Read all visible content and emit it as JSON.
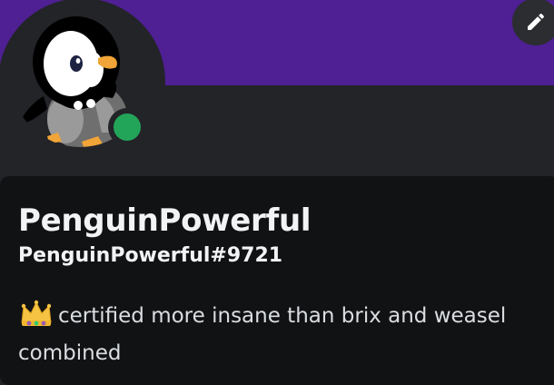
{
  "profile": {
    "display_name": "PenguinPowerful",
    "username": "PenguinPowerful#9721",
    "bio_emoji": "crown-emoji",
    "bio_text": "certified more insane than brix and weasel combined",
    "status": "online"
  },
  "icons": {
    "edit": "pencil-icon",
    "avatar": "penguin-avatar",
    "status": "online-status-dot"
  },
  "colors": {
    "banner": "#4f1f94",
    "status_online": "#23a559",
    "card_background": "#111214",
    "page_background": "#232428"
  }
}
